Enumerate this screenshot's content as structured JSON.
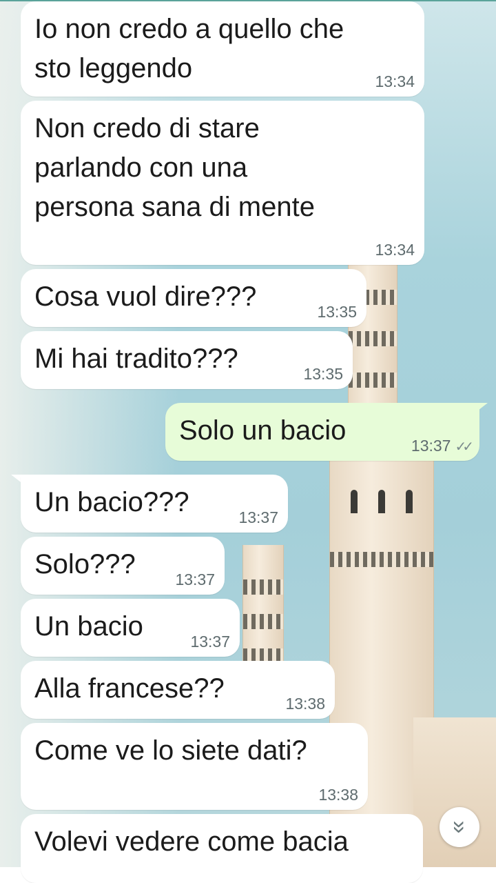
{
  "messages": [
    {
      "id": "m1",
      "dir": "in",
      "text": "Io non credo a quello che\nsto leggendo",
      "time": "13:34"
    },
    {
      "id": "m2",
      "dir": "in",
      "text": "Non credo di stare\nparlando con una\npersona sana di mente",
      "time": "13:34"
    },
    {
      "id": "m3",
      "dir": "in",
      "text": "Cosa vuol dire???",
      "time": "13:35"
    },
    {
      "id": "m4",
      "dir": "in",
      "text": "Mi hai tradito???",
      "time": "13:35"
    },
    {
      "id": "m5",
      "dir": "out",
      "text": "Solo un bacio",
      "time": "13:37"
    },
    {
      "id": "m6",
      "dir": "in",
      "text": "Un bacio???",
      "time": "13:37"
    },
    {
      "id": "m7",
      "dir": "in",
      "text": "Solo???",
      "time": "13:37"
    },
    {
      "id": "m8",
      "dir": "in",
      "text": "Un bacio",
      "time": "13:37"
    },
    {
      "id": "m9",
      "dir": "in",
      "text": "Alla francese??",
      "time": "13:38"
    },
    {
      "id": "m10",
      "dir": "in",
      "text": "Come ve lo siete dati?",
      "time": "13:38"
    },
    {
      "id": "m11",
      "dir": "in",
      "text": "Volevi vedere come bacia",
      "time": ""
    }
  ],
  "read_receipt_icon": "double-check-icon",
  "scroll_button": {
    "icon": "chevron-double-down-icon",
    "glyph": "»"
  },
  "colors": {
    "incoming": "#ffffff",
    "outgoing": "#e7fcd8",
    "time": "#5e6b6e"
  }
}
